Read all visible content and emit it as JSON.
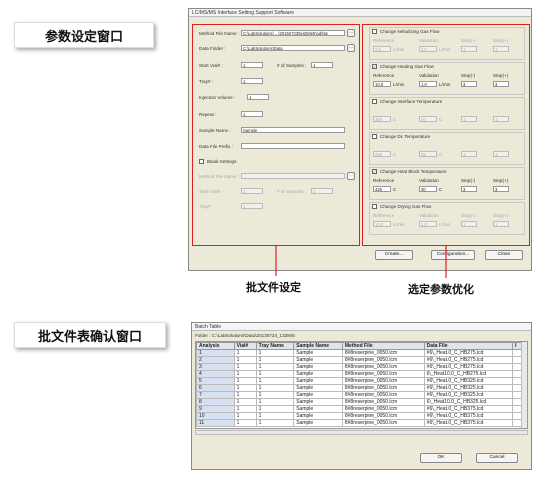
{
  "labels": {
    "param_window": "参数设定窗口",
    "batch_confirm_window": "批文件表确认窗口",
    "batch_setting": "批文件设定",
    "param_optimize": "选定参数优化"
  },
  "win1": {
    "title": "LC/MS/MS Interface Setting Support Software",
    "method_file_label": "Method File Name :",
    "method_file_value": "C:\\LabSolutions\\ ...\\20150723\\test\\Methods\\te",
    "data_folder_label": "Data Folder :",
    "data_folder_value": "C:\\LabSolutions\\Data",
    "start_vial_label": "Start Vial# :",
    "start_vial_value": "1",
    "num_samples_label": "# of Samples :",
    "num_samples_value": "1",
    "tray_label": "Tray# :",
    "tray_value": "1",
    "injection_label": "Injection Volume :",
    "injection_value": "1",
    "repeat_label": "Repeat :",
    "repeat_value": "1",
    "sample_name_label": "Sample Name :",
    "sample_name_value": "Sample",
    "data_prefix_label": "Data File Prefix :",
    "blank_settings_label": "Blank Settings",
    "blank_method_label": "Method File Name :",
    "blank_start_label": "Start Vial# :",
    "blank_start_value": "1",
    "blank_num_label": "# of Samples :",
    "blank_num_value": "1",
    "blank_tray_label": "Tray# :",
    "blank_tray_value": "1",
    "groups": [
      {
        "label": "Change Nebulizing Gas Flow",
        "checked": "",
        "h1": "Reference",
        "h2": "Validation",
        "h3": "Step(-)",
        "h4": "Step(+)",
        "v1": "3.0",
        "u1": "L/min",
        "v2": "3.0",
        "u2": "L/min",
        "v3": "1",
        "v4": "1"
      },
      {
        "label": "Change Heating Gas Flow",
        "checked": "✓",
        "h1": "Reference",
        "h2": "Validation",
        "h3": "Step(-)",
        "h4": "Step(+)",
        "v1": "10.0",
        "u1": "L/min",
        "v2": "1.0",
        "u2": "L/min",
        "v3": "3",
        "v4": "3"
      },
      {
        "label": "Change Interface Temperature",
        "checked": "",
        "h1": "",
        "h2": "",
        "h3": "",
        "h4": "",
        "v1": "300",
        "u1": "C",
        "v2": "50",
        "u2": "C",
        "v3": "1",
        "v4": "1"
      },
      {
        "label": "Change DL Temperature",
        "checked": "",
        "h1": "",
        "h2": "",
        "h3": "",
        "h4": "",
        "v1": "250",
        "u1": "C",
        "v2": "25",
        "u2": "C",
        "v3": "1",
        "v4": "1"
      },
      {
        "label": "Change Heat Block Temperature",
        "checked": "✓",
        "h1": "Reference",
        "h2": "Validation",
        "h3": "Step(-)",
        "h4": "Step(+)",
        "v1": "425",
        "u1": "C",
        "v2": "30",
        "u2": "C",
        "v3": "3",
        "v4": "3"
      },
      {
        "label": "Change Drying Gas Flow",
        "checked": "",
        "h1": "Reference",
        "h2": "Validation",
        "h3": "Step(-)",
        "h4": "Step(+)",
        "v1": "10.0",
        "u1": "L/min",
        "v2": "1.0",
        "u2": "L/min",
        "v3": "1",
        "v4": "1"
      }
    ],
    "create_btn": "Create...",
    "config_btn": "Configuration...",
    "close_btn": "Close"
  },
  "win2": {
    "title": "Batch Table",
    "folder": "Folder : C:\\LabSolutions\\Data\\20130724_133846",
    "headers": [
      "Analysis",
      "Vial#",
      "Tray Name",
      "Sample Name",
      "Method File",
      "Data File",
      "I"
    ],
    "rows": [
      [
        "1",
        "1",
        "1",
        "Sample",
        "8#8reserpine_0050.lcm",
        "#6\\_Heat.0_C_HB275.lcd"
      ],
      [
        "2",
        "1",
        "1",
        "Sample",
        "8#8reserpine_0050.lcm",
        "#6\\_Heat.0_C_HB275.lcd"
      ],
      [
        "3",
        "1",
        "1",
        "Sample",
        "8#8reserpine_0050.lcm",
        "#6\\_Heat.0_C_HB275.lcd"
      ],
      [
        "4",
        "1",
        "1",
        "Sample",
        "8#8reserpine_0050.lcm",
        "6\\_Heat10.0_C_HB275.lcd"
      ],
      [
        "5",
        "1",
        "1",
        "Sample",
        "8#8reserpine_0050.lcm",
        "#6\\_Heat.0_C_HB325.lcd"
      ],
      [
        "6",
        "1",
        "1",
        "Sample",
        "8#8reserpine_0050.lcm",
        "#6\\_Heat.0_C_HB325.lcd"
      ],
      [
        "7",
        "1",
        "1",
        "Sample",
        "8#8reserpine_0050.lcm",
        "#6\\_Heat.0_C_HB325.lcd"
      ],
      [
        "8",
        "1",
        "1",
        "Sample",
        "8#8reserpine_0050.lcm",
        "6\\_Heat10.0_C_HB325.lcd"
      ],
      [
        "9",
        "1",
        "1",
        "Sample",
        "8#8reserpine_0050.lcm",
        "#6\\_Heat.0_C_HB375.lcd"
      ],
      [
        "10",
        "1",
        "1",
        "Sample",
        "8#8reserpine_0050.lcm",
        "#6\\_Heat.0_C_HB375.lcd"
      ],
      [
        "11",
        "1",
        "1",
        "Sample",
        "8#8reserpine_0050.lcm",
        "#6\\_Heat.0_C_HB375.lcd"
      ]
    ],
    "ok_btn": "OK",
    "cancel_btn": "Cancel"
  },
  "colors": {
    "accent_red": "#e02020",
    "window_bg": "#ece9d8",
    "index_col": "#d7e0ef"
  }
}
